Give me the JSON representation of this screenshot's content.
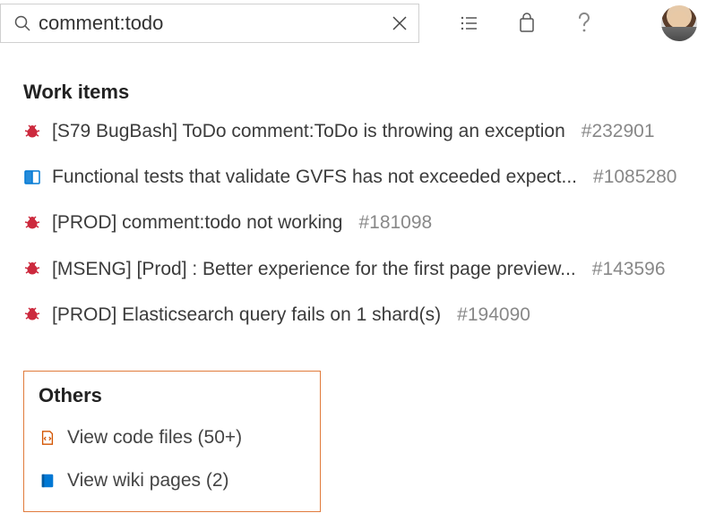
{
  "search": {
    "value": "comment:todo"
  },
  "sections": {
    "workItems": {
      "heading": "Work items",
      "items": [
        {
          "icon": "bug",
          "title": "[S79 BugBash] ToDo comment:ToDo is throwing an exception",
          "id": "#232901"
        },
        {
          "icon": "book",
          "title": "Functional tests that validate GVFS has not exceeded expect...",
          "id": "#1085280"
        },
        {
          "icon": "bug",
          "title": "[PROD] comment:todo not working",
          "id": "#181098"
        },
        {
          "icon": "bug",
          "title": "[MSENG] [Prod] : Better experience for the first page preview...",
          "id": "#143596"
        },
        {
          "icon": "bug",
          "title": "[PROD] Elasticsearch query fails on 1 shard(s)",
          "id": "#194090"
        }
      ]
    },
    "others": {
      "heading": "Others",
      "items": [
        {
          "icon": "code-file",
          "label": "View code files (50+)"
        },
        {
          "icon": "wiki",
          "label": "View wiki pages (2)"
        }
      ]
    }
  },
  "colors": {
    "bug": "#cc293d",
    "book": "#0078d4",
    "codeFile": "#d35400",
    "wiki": "#0078d4",
    "highlight": "#e07b3c"
  }
}
